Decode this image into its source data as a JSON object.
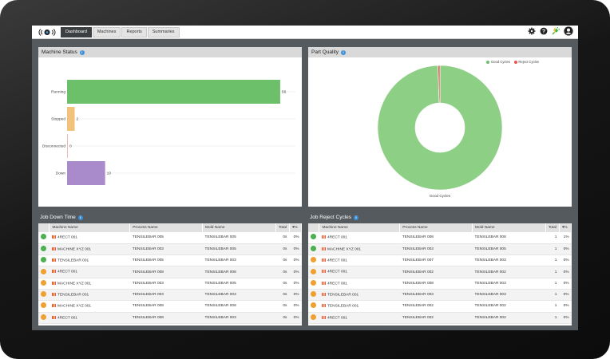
{
  "nav": {
    "tabs": [
      "Dashboard",
      "Machines",
      "Reports",
      "Summaries"
    ],
    "active_tab": "Dashboard"
  },
  "machine_status": {
    "title": "Machine Status",
    "chart_data": {
      "type": "bar",
      "orientation": "horizontal",
      "categories": [
        "Running",
        "Stopped",
        "Disconnected",
        "Down"
      ],
      "values": [
        56,
        2,
        0,
        10
      ],
      "colors": [
        "#6cc06a",
        "#f1c27a",
        "#f0b8b8",
        "#a98bcc"
      ],
      "xlim": [
        0,
        60
      ]
    }
  },
  "part_quality": {
    "title": "Part Quality",
    "chart_data": {
      "type": "pie",
      "style": "donut",
      "labels": [
        "Good Cycles",
        "Reject Cycles"
      ],
      "values": [
        99.5,
        0.5
      ],
      "colors": [
        "#8ecf86",
        "#e8564f"
      ],
      "legend": "top-right"
    }
  },
  "job_down_time": {
    "title": "Job Down Time",
    "columns": [
      "Machine Name",
      "Process Name",
      "Mold Name",
      "Total",
      "%"
    ],
    "rows": [
      {
        "status": "green",
        "machine": "4RECT 001",
        "process": "TENSILEBAR 005",
        "mold": "TENSILEBAR 005",
        "total": "0s",
        "pct": "0%"
      },
      {
        "status": "green",
        "machine": "MACHINE XYZ 001",
        "process": "TENSILEBAR 003",
        "mold": "TENSILEBAR 005",
        "total": "0s",
        "pct": "0%"
      },
      {
        "status": "green",
        "machine": "TENSILEBAR 001",
        "process": "TENSILEBAR 005",
        "mold": "TENSILEBAR 003",
        "total": "0s",
        "pct": "0%"
      },
      {
        "status": "orange",
        "machine": "4RECT 001",
        "process": "TENSILEBAR 008",
        "mold": "TENSILEBAR 008",
        "total": "0s",
        "pct": "0%"
      },
      {
        "status": "orange",
        "machine": "MACHINE XYZ 001",
        "process": "TENSILEBAR 003",
        "mold": "TENSILEBAR 005",
        "total": "0s",
        "pct": "0%"
      },
      {
        "status": "orange",
        "machine": "TENSILEBAR 001",
        "process": "TENSILEBAR 003",
        "mold": "TENSILEBAR 003",
        "total": "0s",
        "pct": "0%"
      },
      {
        "status": "orange",
        "machine": "MACHINE XYZ 001",
        "process": "TENSILEBAR 008",
        "mold": "TENSILEBAR 008",
        "total": "0s",
        "pct": "0%"
      },
      {
        "status": "orange",
        "machine": "4RECT 001",
        "process": "TENSILEBAR 008",
        "mold": "TENSILEBAR 003",
        "total": "0s",
        "pct": "0%"
      }
    ]
  },
  "job_reject_cycles": {
    "title": "Job Reject Cycles",
    "columns": [
      "Machine Name",
      "Process Name",
      "Mold Name",
      "Total",
      "%"
    ],
    "rows": [
      {
        "status": "green",
        "machine": "4RECT 001",
        "process": "TENSILEBAR 008",
        "mold": "TENSILEBAR 008",
        "total": "1",
        "pct": "1%"
      },
      {
        "status": "green",
        "machine": "MACHINE XYZ 001",
        "process": "TENSILEBAR 003",
        "mold": "TENSILEBAR 005",
        "total": "1",
        "pct": "0%"
      },
      {
        "status": "orange",
        "machine": "4RECT 001",
        "process": "TENSILEBAR 007",
        "mold": "TENSILEBAR 003",
        "total": "1",
        "pct": "0%"
      },
      {
        "status": "orange",
        "machine": "4RECT 001",
        "process": "TENSILEBAR 002",
        "mold": "TENSILEBAR 002",
        "total": "1",
        "pct": "0%"
      },
      {
        "status": "orange",
        "machine": "4RECT 001",
        "process": "TENSILEBAR 008",
        "mold": "TENSILEBAR 003",
        "total": "1",
        "pct": "0%"
      },
      {
        "status": "orange",
        "machine": "TENSILEBAR 001",
        "process": "TENSILEBAR 003",
        "mold": "TENSILEBAR 003",
        "total": "1",
        "pct": "0%"
      },
      {
        "status": "orange",
        "machine": "TENSILEBAR 001",
        "process": "TENSILEBAR 002",
        "mold": "TENSILEBAR 002",
        "total": "1",
        "pct": "0%"
      },
      {
        "status": "orange",
        "machine": "4RECT 001",
        "process": "TENSILEBAR 002",
        "mold": "TENSILEBAR 002",
        "total": "1",
        "pct": "0%"
      }
    ]
  }
}
